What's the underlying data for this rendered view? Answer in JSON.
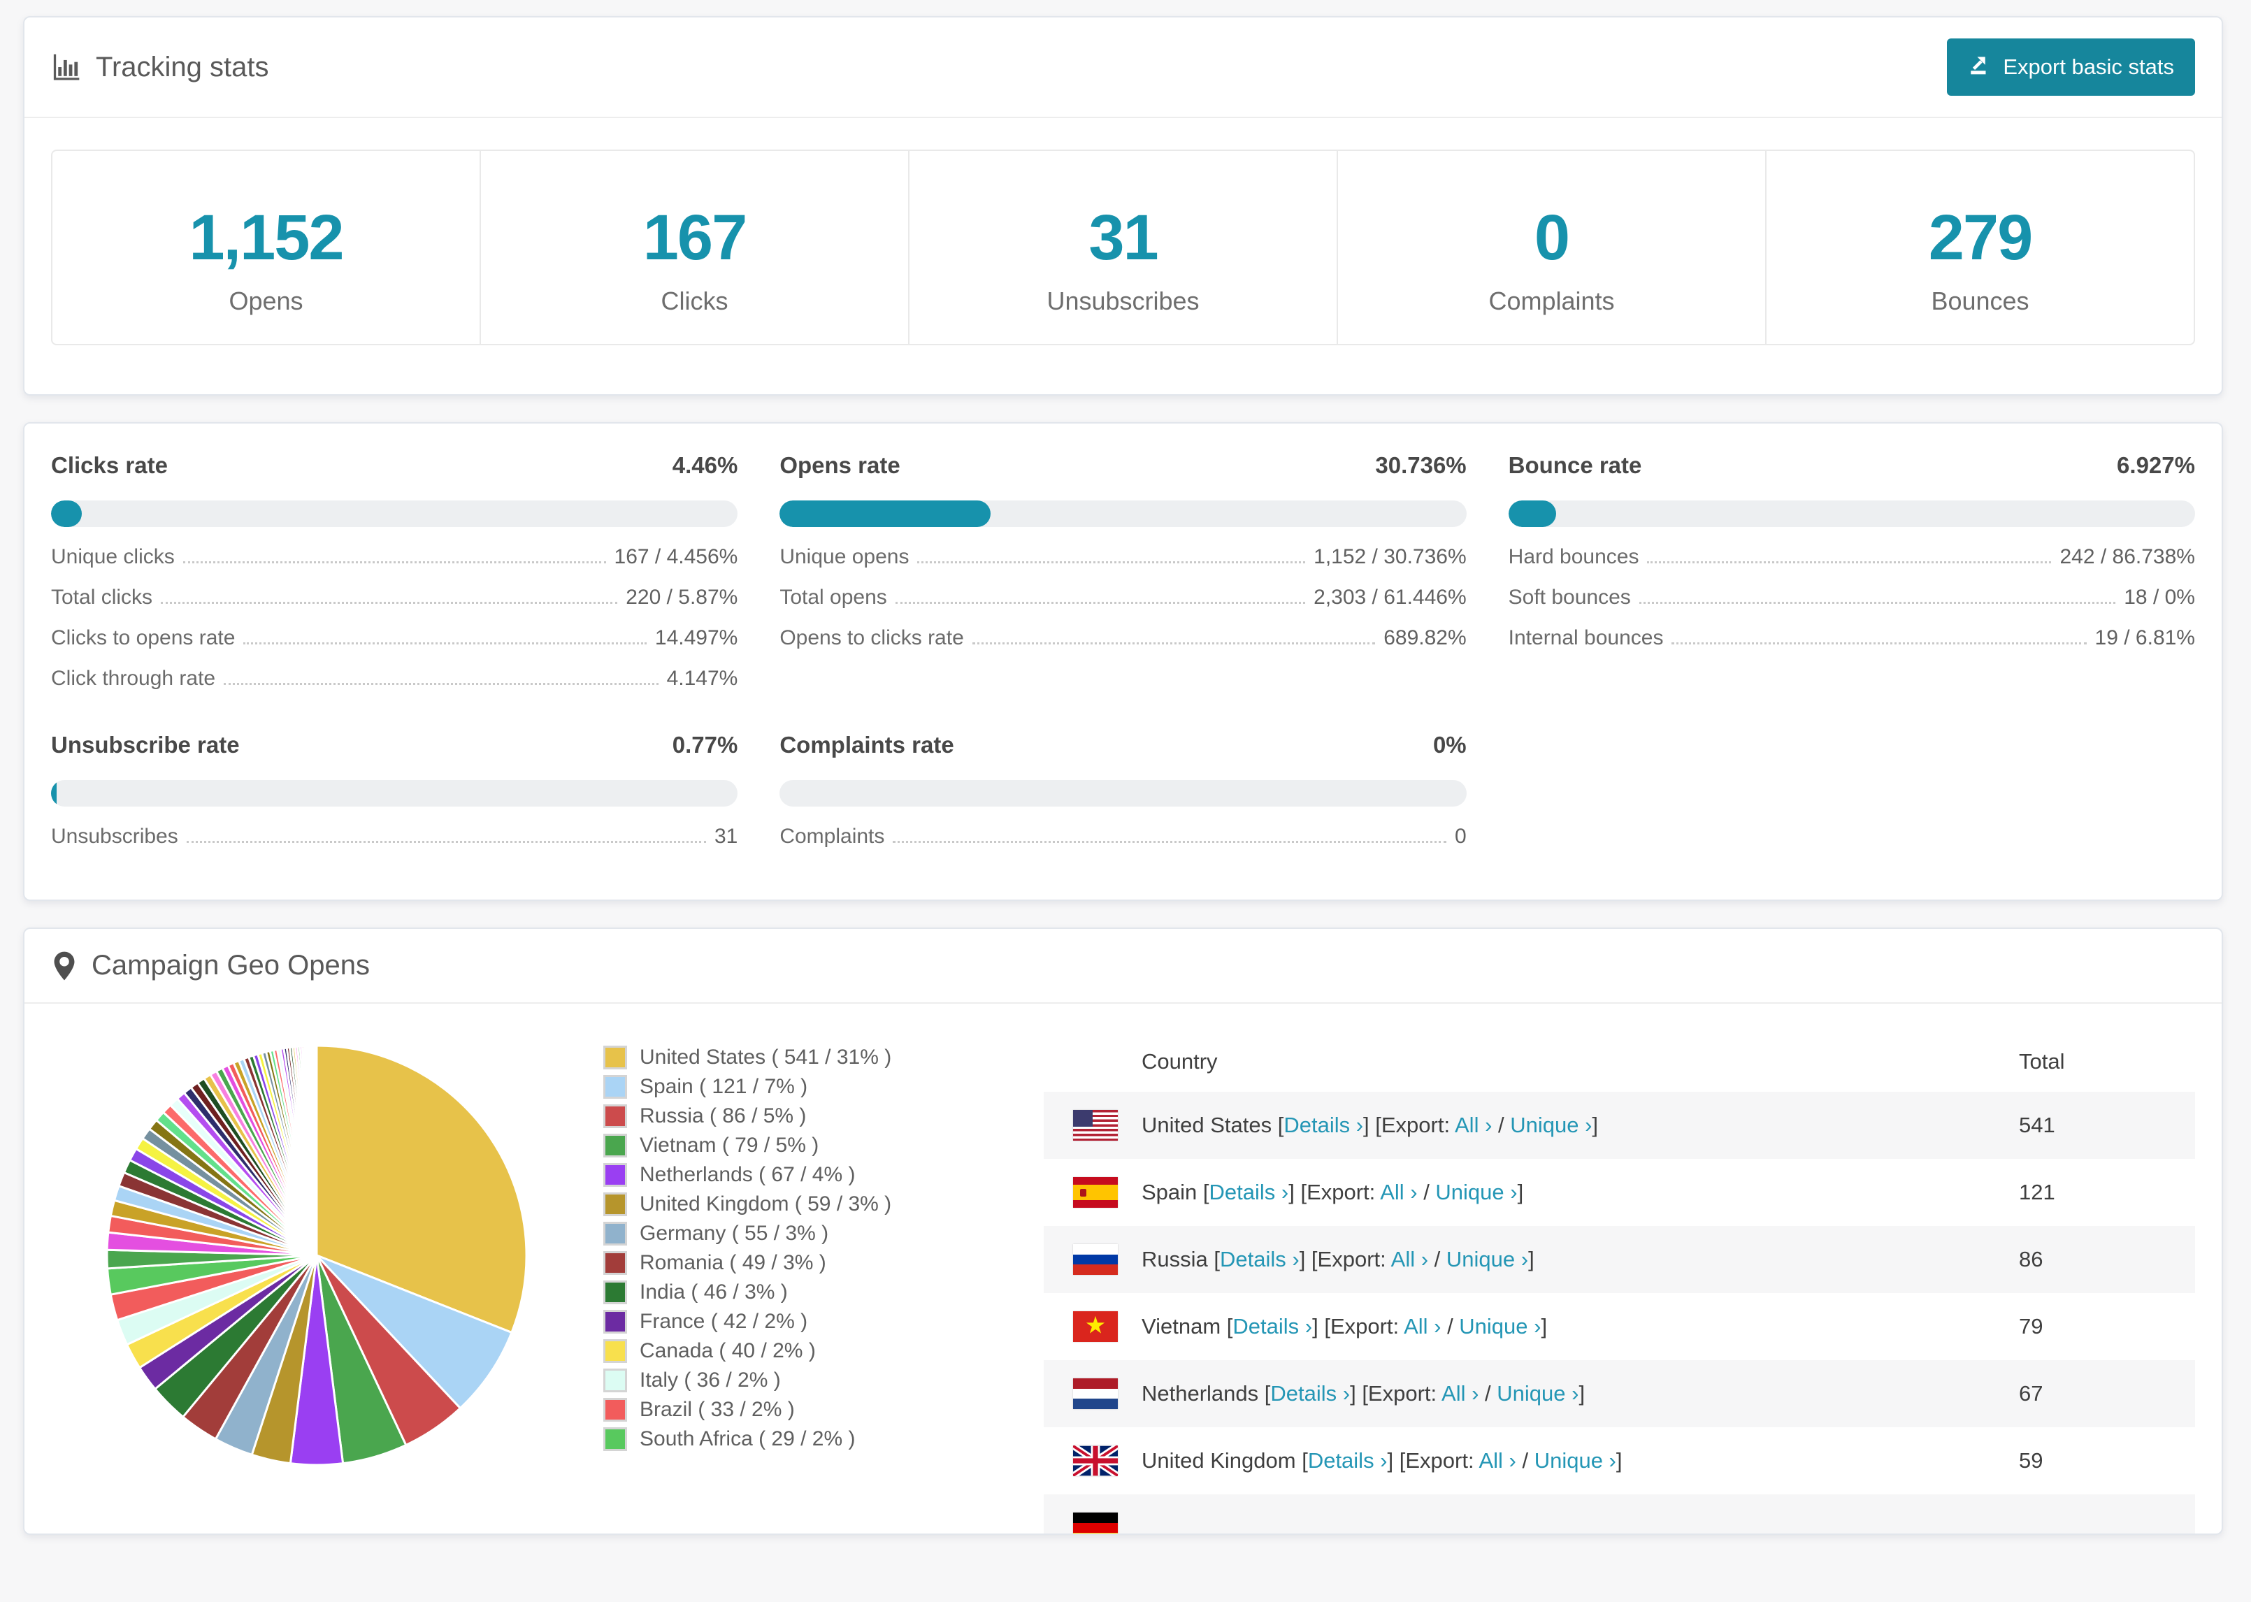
{
  "accent": "#1792ac",
  "header": {
    "title": "Tracking stats",
    "export_button": "Export basic stats"
  },
  "summary": [
    {
      "value": "1,152",
      "label": "Opens"
    },
    {
      "value": "167",
      "label": "Clicks"
    },
    {
      "value": "31",
      "label": "Unsubscribes"
    },
    {
      "value": "0",
      "label": "Complaints"
    },
    {
      "value": "279",
      "label": "Bounces"
    }
  ],
  "rates": [
    {
      "title": "Clicks rate",
      "value": "4.46%",
      "percent": 4.46,
      "rows": [
        [
          "Unique clicks",
          "167 / 4.456%"
        ],
        [
          "Total clicks",
          "220 / 5.87%"
        ],
        [
          "Clicks to opens rate",
          "14.497%"
        ],
        [
          "Click through rate",
          "4.147%"
        ]
      ]
    },
    {
      "title": "Opens rate",
      "value": "30.736%",
      "percent": 30.736,
      "rows": [
        [
          "Unique opens",
          "1,152 / 30.736%"
        ],
        [
          "Total opens",
          "2,303 / 61.446%"
        ],
        [
          "Opens to clicks rate",
          "689.82%"
        ]
      ]
    },
    {
      "title": "Bounce rate",
      "value": "6.927%",
      "percent": 6.927,
      "rows": [
        [
          "Hard bounces",
          "242 / 86.738%"
        ],
        [
          "Soft bounces",
          "18 / 0%"
        ],
        [
          "Internal bounces",
          "19 / 6.81%"
        ]
      ]
    },
    {
      "title": "Unsubscribe rate",
      "value": "0.77%",
      "percent": 0.77,
      "rows": [
        [
          "Unsubscribes",
          "31"
        ]
      ]
    },
    {
      "title": "Complaints rate",
      "value": "0%",
      "percent": 0,
      "rows": [
        [
          "Complaints",
          "0"
        ]
      ]
    }
  ],
  "geo": {
    "title": "Campaign Geo Opens",
    "chart_data": {
      "type": "pie",
      "title": "Campaign Geo Opens",
      "labels": [
        "United States",
        "Spain",
        "Russia",
        "Vietnam",
        "Netherlands",
        "United Kingdom",
        "Germany",
        "Romania",
        "India",
        "France",
        "Canada",
        "Italy",
        "Brazil",
        "South Africa"
      ],
      "values": [
        541,
        121,
        86,
        79,
        67,
        59,
        55,
        49,
        46,
        42,
        40,
        36,
        33,
        29
      ],
      "percents": [
        31,
        7,
        5,
        5,
        4,
        3,
        3,
        3,
        3,
        2,
        2,
        2,
        2,
        2
      ],
      "colors": [
        "#e7c24a",
        "#aad4f5",
        "#cc4b4c",
        "#4aa64e",
        "#9a3ff2",
        "#b6952c",
        "#90b2cc",
        "#a23d3a",
        "#2c7a33",
        "#6c2ba2",
        "#f8e04d",
        "#dcfcf3",
        "#f25c5c",
        "#58c95e"
      ],
      "legend_labels": [
        "United States ( 541 / 31% )",
        "Spain ( 121 / 7% )",
        "Russia ( 86 / 5% )",
        "Vietnam ( 79 / 5% )",
        "Netherlands ( 67 / 4% )",
        "United Kingdom ( 59 / 3% )",
        "Germany ( 55 / 3% )",
        "Romania ( 49 / 3% )",
        "India ( 46 / 3% )",
        "France ( 42 / 2% )",
        "Canada ( 40 / 2% )",
        "Italy ( 36 / 2% )",
        "Brazil ( 33 / 2% )",
        "South Africa ( 29 / 2% )"
      ],
      "others_percent": 26,
      "others_palette": [
        "#4aa64e",
        "#e44fe0",
        "#f25c5c",
        "#c9a227",
        "#aad4f5",
        "#8a3434",
        "#2c7a33",
        "#8a46e8",
        "#f5f243",
        "#75909f",
        "#857514",
        "#63e08b",
        "#fc6a6a",
        "#e7fffa",
        "#b44df0",
        "#2d2d6b",
        "#6e2020",
        "#1e4d22",
        "#e7c24a",
        "#f780df"
      ],
      "start_angle": "top",
      "direction": "clockwise",
      "legend_position": "right"
    },
    "table": {
      "columns": [
        "Country",
        "Total"
      ],
      "link_parts": {
        "open": " [",
        "details": "Details ›",
        "mid": "] [Export: ",
        "all": "All ›",
        "sep": " / ",
        "unique": "Unique ›",
        "close": "]"
      },
      "rows": [
        {
          "flag": "us",
          "country": "United States",
          "total": "541"
        },
        {
          "flag": "es",
          "country": "Spain",
          "total": "121"
        },
        {
          "flag": "ru",
          "country": "Russia",
          "total": "86"
        },
        {
          "flag": "vn",
          "country": "Vietnam",
          "total": "79"
        },
        {
          "flag": "nl",
          "country": "Netherlands",
          "total": "67"
        },
        {
          "flag": "gb",
          "country": "United Kingdom",
          "total": "59"
        },
        {
          "flag": "de",
          "country": "",
          "total": ""
        }
      ]
    }
  }
}
